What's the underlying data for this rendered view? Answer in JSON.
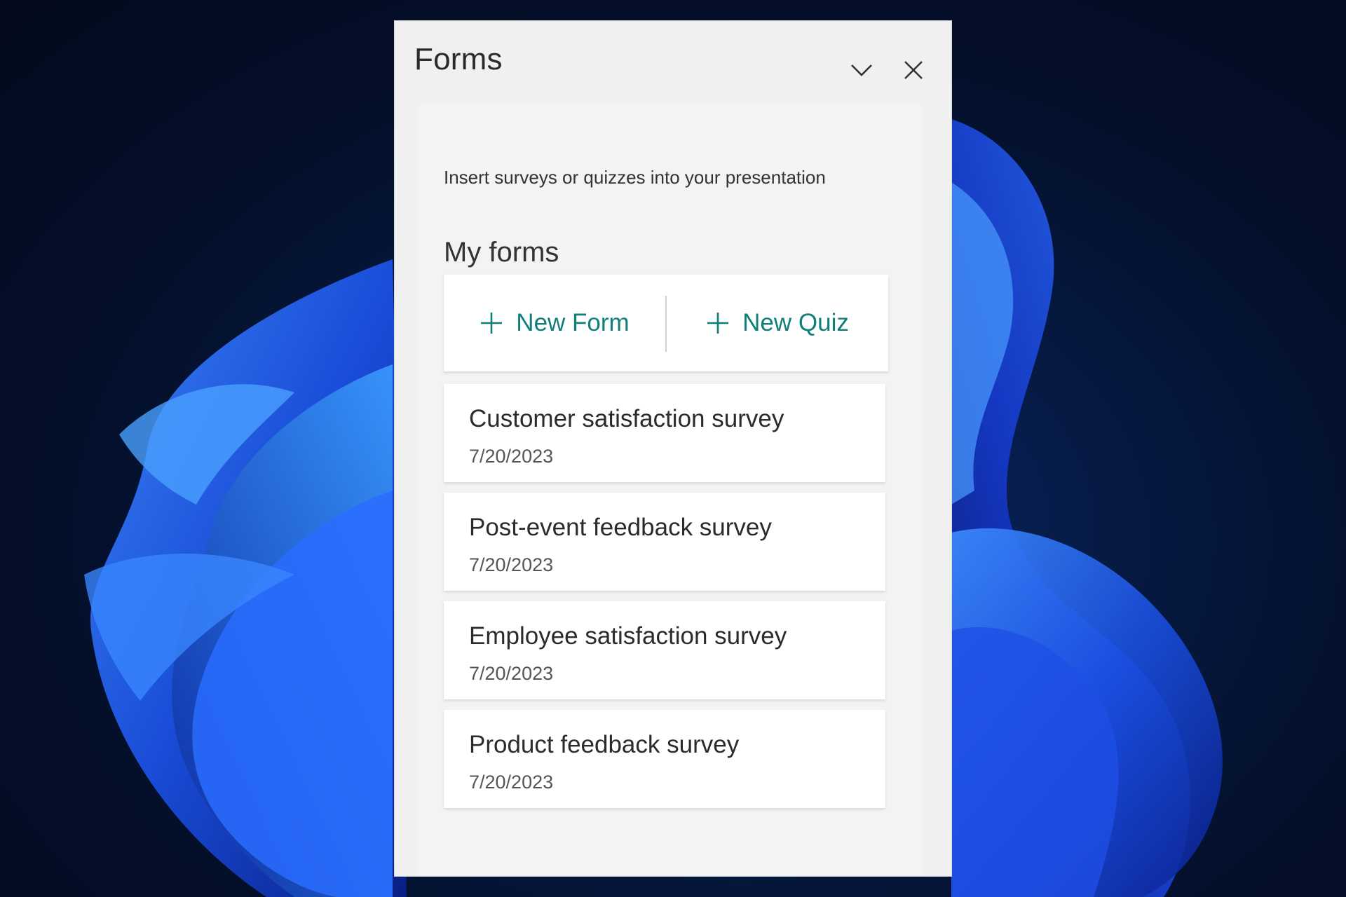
{
  "window": {
    "title": "Forms",
    "collapse_icon": "chevron-down-icon",
    "close_icon": "close-icon"
  },
  "panel": {
    "intro_text": "Insert surveys or quizzes into your presentation",
    "section_title": "My forms",
    "new_form_label": "New Form",
    "new_quiz_label": "New Quiz",
    "accent_color": "#0f7f7a"
  },
  "forms": [
    {
      "name": "Customer satisfaction survey",
      "date": "7/20/2023"
    },
    {
      "name": "Post-event feedback survey",
      "date": "7/20/2023"
    },
    {
      "name": "Employee satisfaction survey",
      "date": "7/20/2023"
    },
    {
      "name": "Product feedback survey",
      "date": "7/20/2023"
    }
  ]
}
